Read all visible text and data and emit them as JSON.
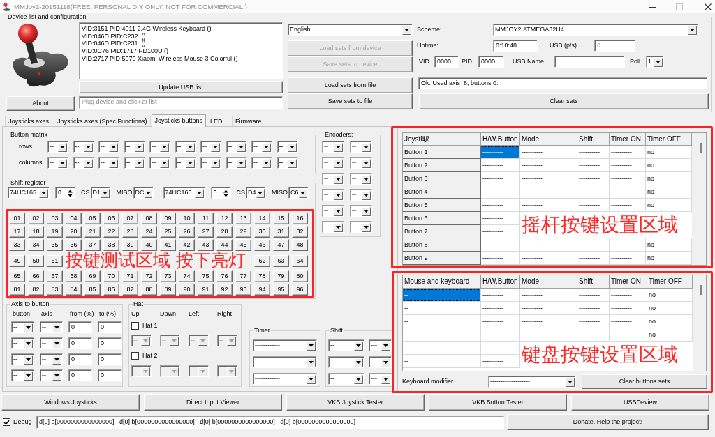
{
  "window": {
    "title": "MMJoy2-20151118(FREE. PERSONAL DIY ONLY. NOT FOR COMMERCIAL.)"
  },
  "device_panel": {
    "title": "Device list and configuration",
    "about_button": "About",
    "devices": [
      "VID:3151 PID:4011 2.4G Wireless Keyboard ()",
      "VID:046D PID:C232  ()",
      "VID:046D PID:C231  ()",
      "VID:0C76 PID:1717 PD100U ()",
      "VID:2717 PID:5070 Xiaomi Wireless Mouse 3 Colorful ()"
    ],
    "update_button": "Update USB list",
    "status_field": {
      "placeholder": "Plug device and click at list"
    },
    "language": "English",
    "buttons": [
      {
        "label": "Load sets from device",
        "disabled": true
      },
      {
        "label": "Save sets to device",
        "disabled": true
      },
      {
        "label": "Load sets from file",
        "disabled": false
      },
      {
        "label": "Save sets to file",
        "disabled": false
      }
    ],
    "scheme": {
      "label": "Scheme:",
      "value": "MMJOY2.ATMEGA32U4"
    },
    "uptime": {
      "label": "Uptime:",
      "value": "0:10:48"
    },
    "usb_rate": {
      "label": "USB (p/s)",
      "value": "0",
      "disabled": true
    },
    "vid": {
      "label": "VID",
      "value": "0000"
    },
    "pid": {
      "label": "PID",
      "value": "0000"
    },
    "usb_name": {
      "label": "USB Name"
    },
    "poll": {
      "label": "Poll",
      "value": "1"
    },
    "message": "Ok. Used axis  8, buttons 0.",
    "clear_button": "Clear sets"
  },
  "tabs": [
    {
      "label": "Joysticks axes",
      "selected": false
    },
    {
      "label": "Joysticks axes (Spec.Functions)",
      "selected": false
    },
    {
      "label": "Joysticks buttons",
      "selected": true
    },
    {
      "label": "LED",
      "selected": false
    },
    {
      "label": "Firmware",
      "selected": false
    }
  ],
  "button_matrix": {
    "title": "Button matrix",
    "rows": [
      {
        "label": "rows",
        "selects": [
          "--",
          "--",
          "--",
          "--",
          "--",
          "--",
          "--",
          "--",
          "--",
          "--"
        ]
      },
      {
        "label": "columns",
        "selects": [
          "--",
          "--",
          "--",
          "--",
          "--",
          "--",
          "--",
          "--",
          "--",
          "--"
        ]
      }
    ]
  },
  "shift_register": {
    "title": "Shift register",
    "chains": [
      {
        "chip": "74HC165",
        "count": "0",
        "cs_label": "CS",
        "cs": "D1",
        "miso_label": "MISO",
        "miso": "DC"
      },
      {
        "chip": "74HC165",
        "count": "0",
        "cs_label": "CS",
        "cs": "D4",
        "miso_label": "MISO",
        "miso": "C6"
      }
    ]
  },
  "button_test": {
    "rows": [
      {
        "buttons": [
          "01",
          "02",
          "03",
          "04",
          "05",
          "06",
          "07",
          "08",
          "09",
          "10",
          "11",
          "12",
          "13",
          "14",
          "15",
          "16"
        ]
      },
      {
        "buttons": [
          "17",
          "18",
          "19",
          "20",
          "21",
          "22",
          "23",
          "24",
          "25",
          "26",
          "27",
          "28",
          "29",
          "30",
          "31",
          "32"
        ]
      },
      {
        "buttons": [
          "33",
          "34",
          "35",
          "36",
          "37",
          "38",
          "39",
          "40",
          "41",
          "42",
          "43",
          "44",
          "45",
          "46",
          "47",
          "48"
        ]
      },
      {
        "buttons": [
          "49",
          "50",
          "51"
        ],
        "annotation": "按键测试区域 按下亮灯",
        "buttons_after": [
          "62",
          "63",
          "64"
        ]
      },
      {
        "buttons": [
          "65",
          "66",
          "67",
          "68",
          "69",
          "70",
          "71",
          "72",
          "73",
          "74",
          "75",
          "76",
          "77",
          "78",
          "79",
          "80"
        ]
      },
      {
        "buttons": [
          "81",
          "82",
          "83",
          "84",
          "85",
          "86",
          "87",
          "88",
          "89",
          "90",
          "91",
          "92",
          "93",
          "94",
          "95",
          "96"
        ]
      }
    ]
  },
  "encoders": {
    "title": "Encoders:",
    "rows": [
      [
        "--",
        "--"
      ],
      [
        "--",
        "--"
      ],
      [
        "--",
        "--"
      ],
      [
        "--",
        "--"
      ],
      [
        "--",
        "--"
      ],
      [
        "--",
        "--"
      ]
    ]
  },
  "joystick_table": {
    "annotation": "摇杆按键设置区域",
    "row_headers": true,
    "columns": [
      "Joysti駅",
      "H/W.Button",
      "Mode",
      "Shift",
      "Timer ON",
      "Timer OFF"
    ],
    "rows": [
      {
        "cells": [
          "Button 1",
          "----------",
          "----------",
          "----------",
          "----------",
          "no"
        ],
        "selected": true
      },
      {
        "cells": [
          "Button 2",
          "----------",
          "----------",
          "----------",
          "----------",
          "no"
        ],
        "selected": false
      },
      {
        "cells": [
          "Button 3",
          "----------",
          "----------",
          "----------",
          "----------",
          "no"
        ],
        "selected": false
      },
      {
        "cells": [
          "Button 4",
          "----------",
          "----------",
          "----------",
          "----------",
          "no"
        ],
        "selected": false
      },
      {
        "cells": [
          "Button 5",
          "----------",
          "----------",
          "----------",
          "----------",
          "no"
        ],
        "selected": false
      },
      {
        "cells": [
          "Button 6",
          "----------"
        ],
        "selected": false
      },
      {
        "cells": [
          "Button 7",
          "----------"
        ],
        "selected": false
      },
      {
        "cells": [
          "Button 8",
          "----------",
          "----------",
          "----------",
          "----------",
          "no"
        ],
        "selected": false
      },
      {
        "cells": [
          "Button 9",
          "----------",
          "----------",
          "----------",
          "----------",
          "no"
        ],
        "selected": false
      }
    ]
  },
  "keyboard_table": {
    "annotation": "键盘按键设置区域",
    "row_headers": false,
    "columns": [
      "Mouse and keyboard",
      "H/W.Button",
      "Mode",
      "Shift",
      "Timer ON",
      "Timer OFF"
    ],
    "rows": [
      {
        "cells": [
          "--",
          "----------",
          "----------",
          "----------",
          "----------",
          "no"
        ],
        "selected": true
      },
      {
        "cells": [
          "--",
          "----------",
          "----------",
          "----------",
          "----------",
          "no"
        ],
        "selected": false
      },
      {
        "cells": [
          "--",
          "----------",
          "----------",
          "----------",
          "----------",
          "no"
        ],
        "selected": false
      },
      {
        "cells": [
          "--",
          "----------",
          "----------",
          "----------",
          "----------",
          "no"
        ],
        "selected": false
      },
      {
        "cells": [
          "--",
          "----------"
        ],
        "selected": false
      },
      {
        "cells": [
          "--",
          "----------"
        ],
        "selected": false
      }
    ],
    "modifier": {
      "label": "Keyboard modifier",
      "value": "-------------------"
    },
    "clear_button": "Clear buttons sets"
  },
  "axis_to_button": {
    "title": "Axis to button",
    "headers": [
      "button",
      "axis",
      "from (%)",
      "to (%)"
    ],
    "rows": [
      {
        "button": "--",
        "axis": "--",
        "from": "0",
        "to": "0"
      },
      {
        "button": "--",
        "axis": "--",
        "from": "0",
        "to": "0"
      },
      {
        "button": "--",
        "axis": "--",
        "from": "0",
        "to": "0"
      },
      {
        "button": "--",
        "axis": "--",
        "from": "0",
        "to": "0"
      }
    ]
  },
  "hat": {
    "title": "Hat",
    "headers": [
      "Up",
      "Down",
      "Left",
      "Right"
    ],
    "hats": [
      {
        "label": "Hat 1",
        "checked": false,
        "selects": [
          "--",
          "--",
          "--",
          "--"
        ]
      },
      {
        "label": "Hat 2",
        "checked": false,
        "selects": [
          "--",
          "--",
          "--",
          "--"
        ]
      }
    ]
  },
  "timer": {
    "title": "Timer",
    "selects": [
      "------------",
      "------------",
      "------------"
    ]
  },
  "shift": {
    "title": "Shift",
    "rows": [
      [
        "--",
        "---"
      ],
      [
        "--",
        "---"
      ],
      [
        "--",
        "---"
      ]
    ]
  },
  "tools": [
    "Windows Joysticks",
    "Direct Input Viewer",
    "VKB Joystick Tester",
    "VKB Button Tester",
    "USBDeview"
  ],
  "debug": {
    "label": "Debug",
    "checked": true,
    "output": "d[0] b[0000000000000000]   d[0] b[0000000000000000]   d[0] b[0000000000000000]   d[0] b[0000000000000000]"
  },
  "donate_button": "Donate. Help the project!"
}
